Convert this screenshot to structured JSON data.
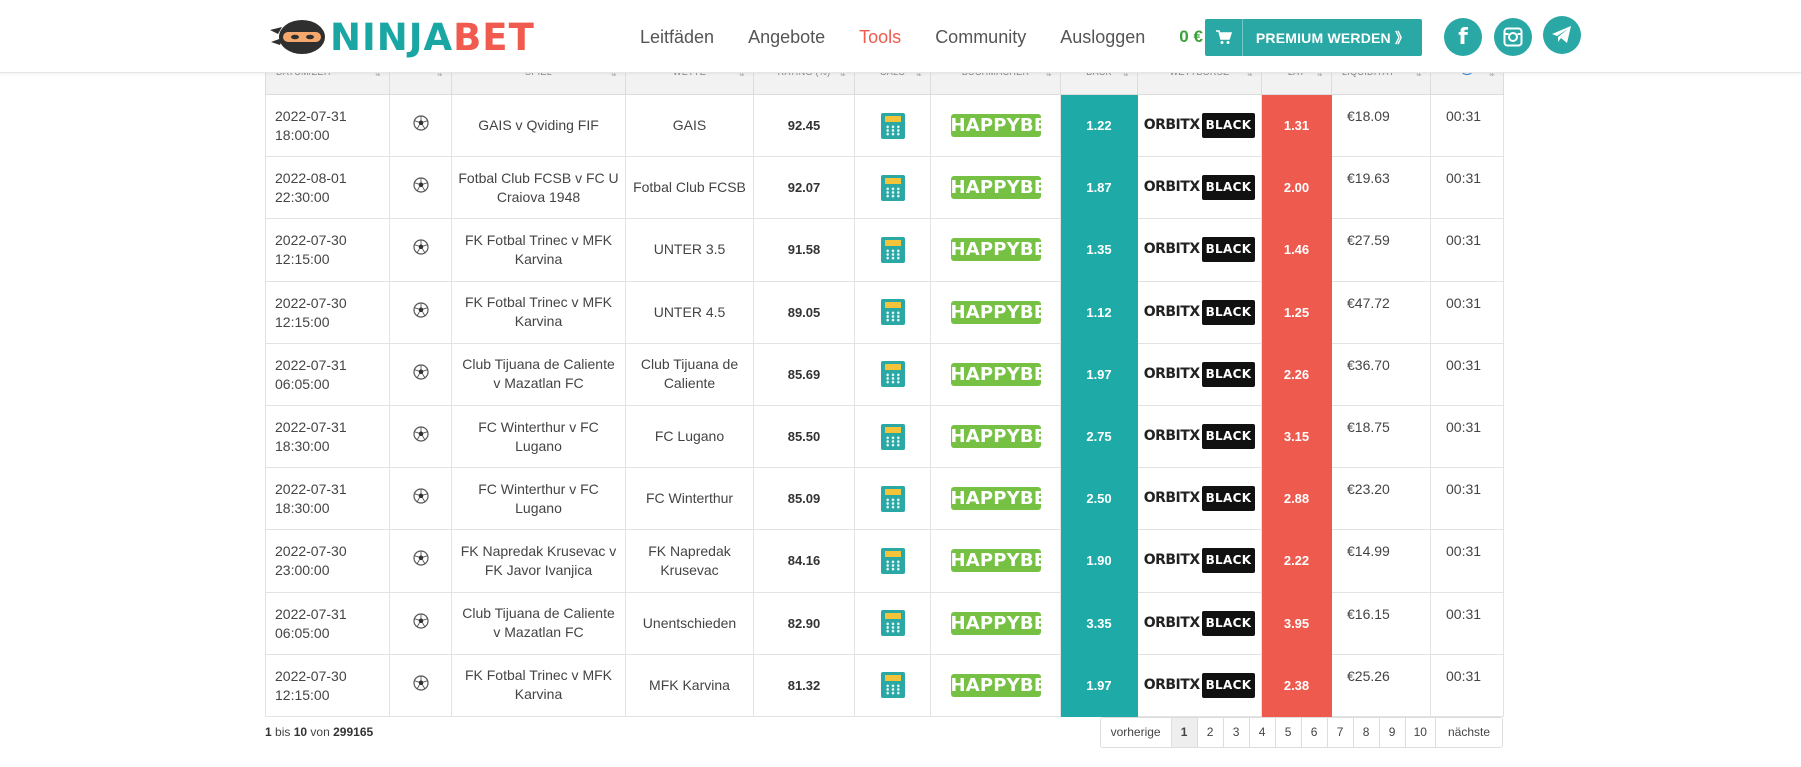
{
  "header": {
    "logo": {
      "part1": "NINJA",
      "part2": "BET"
    },
    "nav": [
      {
        "label": "Leitfäden",
        "active": false
      },
      {
        "label": "Angebote",
        "active": false
      },
      {
        "label": "Tools",
        "active": true
      },
      {
        "label": "Community",
        "active": false
      },
      {
        "label": "Ausloggen",
        "active": false
      }
    ],
    "balance": "0 €",
    "premium_label": "PREMIUM WERDEN 》",
    "social": [
      "facebook-icon",
      "instagram-icon",
      "telegram-icon"
    ]
  },
  "table": {
    "columns": [
      "DATUM/ZEIT",
      "",
      "SPIEL",
      "WETTE",
      "RATING (%)",
      "CALC",
      "BUCHMACHER",
      "BACK",
      "WETTBÖRSE",
      "LAY",
      "LIQUIDITÄT",
      ""
    ],
    "rows": [
      {
        "date": "2022-07-31",
        "time": "18:00:00",
        "game": "GAIS v Qviding FIF",
        "bet": "GAIS",
        "rating": "92.45",
        "back": "1.22",
        "lay": "1.31",
        "liquidity": "€18.09",
        "updated": "00:31"
      },
      {
        "date": "2022-08-01",
        "time": "22:30:00",
        "game": "Fotbal Club FCSB v FC U Craiova 1948",
        "bet": "Fotbal Club FCSB",
        "rating": "92.07",
        "back": "1.87",
        "lay": "2.00",
        "liquidity": "€19.63",
        "updated": "00:31"
      },
      {
        "date": "2022-07-30",
        "time": "12:15:00",
        "game": "FK Fotbal Trinec v MFK Karvina",
        "bet": "UNTER 3.5",
        "rating": "91.58",
        "back": "1.35",
        "lay": "1.46",
        "liquidity": "€27.59",
        "updated": "00:31"
      },
      {
        "date": "2022-07-30",
        "time": "12:15:00",
        "game": "FK Fotbal Trinec v MFK Karvina",
        "bet": "UNTER 4.5",
        "rating": "89.05",
        "back": "1.12",
        "lay": "1.25",
        "liquidity": "€47.72",
        "updated": "00:31"
      },
      {
        "date": "2022-07-31",
        "time": "06:05:00",
        "game": "Club Tijuana de Caliente v Mazatlan FC",
        "bet": "Club Tijuana de Caliente",
        "rating": "85.69",
        "back": "1.97",
        "lay": "2.26",
        "liquidity": "€36.70",
        "updated": "00:31"
      },
      {
        "date": "2022-07-31",
        "time": "18:30:00",
        "game": "FC Winterthur v FC Lugano",
        "bet": "FC Lugano",
        "rating": "85.50",
        "back": "2.75",
        "lay": "3.15",
        "liquidity": "€18.75",
        "updated": "00:31"
      },
      {
        "date": "2022-07-31",
        "time": "18:30:00",
        "game": "FC Winterthur v FC Lugano",
        "bet": "FC Winterthur",
        "rating": "85.09",
        "back": "2.50",
        "lay": "2.88",
        "liquidity": "€23.20",
        "updated": "00:31"
      },
      {
        "date": "2022-07-30",
        "time": "23:00:00",
        "game": "FK Napredak Krusevac v FK Javor Ivanjica",
        "bet": "FK Napredak Krusevac",
        "rating": "84.16",
        "back": "1.90",
        "lay": "2.22",
        "liquidity": "€14.99",
        "updated": "00:31"
      },
      {
        "date": "2022-07-31",
        "time": "06:05:00",
        "game": "Club Tijuana de Caliente v Mazatlan FC",
        "bet": "Unentschieden",
        "rating": "82.90",
        "back": "3.35",
        "lay": "3.95",
        "liquidity": "€16.15",
        "updated": "00:31"
      },
      {
        "date": "2022-07-30",
        "time": "12:15:00",
        "game": "FK Fotbal Trinec v MFK Karvina",
        "bet": "MFK Karvina",
        "rating": "81.32",
        "back": "1.97",
        "lay": "2.38",
        "liquidity": "€25.26",
        "updated": "00:31"
      }
    ],
    "bookmaker": "HAPPYBET",
    "exchange": {
      "part1": "ORBITX",
      "part2": "BLACK"
    }
  },
  "footer": {
    "range_start": "1",
    "range_mid": "bis",
    "range_end": "10",
    "range_of": "von",
    "total": "299165",
    "pagination": {
      "prev": "vorherige",
      "pages": [
        "1",
        "2",
        "3",
        "4",
        "5",
        "6",
        "7",
        "8",
        "9",
        "10"
      ],
      "current": "1",
      "next": "nächste"
    }
  },
  "colors": {
    "teal": "#1eaba7",
    "red": "#ee5a4e",
    "green": "#76c043",
    "balance_green": "#3aa13a"
  }
}
